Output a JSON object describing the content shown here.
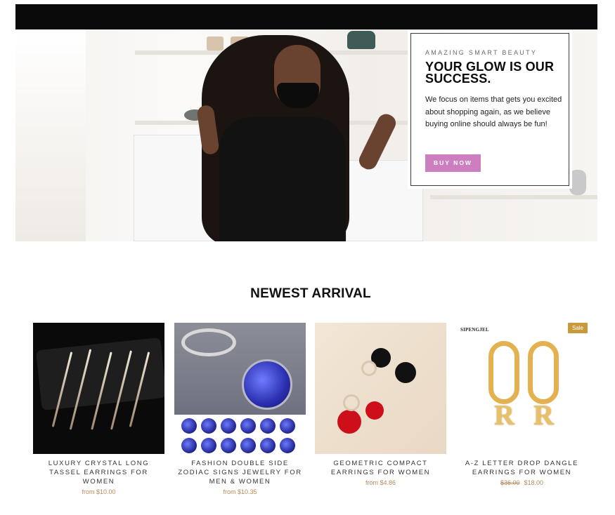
{
  "hero": {
    "eyebrow": "AMAZING SMART BEAUTY",
    "headline": "YOUR GLOW IS OUR SUCCESS.",
    "body": "We focus on items that gets you excited about shopping again, as we believe buying online should always be fun!",
    "cta_label": "BUY NOW",
    "cta_color": "#cd7ec0"
  },
  "section": {
    "title": "NEWEST ARRIVAL"
  },
  "products": [
    {
      "name": "LUXURY CRYSTAL LONG TASSEL EARRINGS FOR WOMEN",
      "price": "from $10.00"
    },
    {
      "name": "FASHION DOUBLE SIDE ZODIAC SIGNS JEWELRY FOR MEN & WOMEN",
      "price": "from $10.35"
    },
    {
      "name": "GEOMETRIC COMPACT EARRINGS FOR WOMEN",
      "price": "from $4.86"
    },
    {
      "name": "A-Z LETTER DROP DANGLE EARRINGS FOR WOMEN",
      "old_price": "$36.00",
      "price": "$18.00",
      "badge": "Sale",
      "brand_mark": "SIPENGJEL",
      "letter": "R"
    }
  ],
  "colors": {
    "price": "#b48a5a",
    "sale_badge": "#c99a3c",
    "top_bar": "#0a0a0a"
  }
}
